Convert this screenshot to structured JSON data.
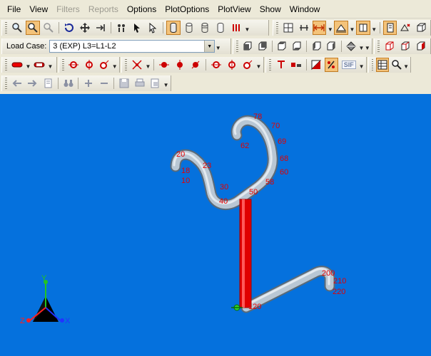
{
  "menu": {
    "items": [
      {
        "label": "File",
        "enabled": true
      },
      {
        "label": "View",
        "enabled": true
      },
      {
        "label": "Filters",
        "enabled": false
      },
      {
        "label": "Reports",
        "enabled": false
      },
      {
        "label": "Options",
        "enabled": true
      },
      {
        "label": "PlotOptions",
        "enabled": true
      },
      {
        "label": "PlotView",
        "enabled": true
      },
      {
        "label": "Show",
        "enabled": true
      },
      {
        "label": "Window",
        "enabled": true
      }
    ]
  },
  "load_case": {
    "label": "Load Case:",
    "value": "3 (EXP) L3=L1-L2"
  },
  "toolbar3": {
    "sif_label": "SIF"
  },
  "viewport": {
    "background": "#0571dd",
    "pipe_color": "#a9b9c8",
    "highlight_color": "#e00000",
    "node_labels": [
      "78",
      "70",
      "69",
      "68",
      "62",
      "20",
      "23",
      "18",
      "10",
      "30",
      "60",
      "58",
      "50",
      "40",
      "200",
      "210",
      "220",
      "120"
    ]
  },
  "axes": {
    "y": "Y",
    "x": "X",
    "z": "Z"
  },
  "colors": {
    "menubar_bg": "#ece9d8",
    "node_label": "#e40000",
    "pressed_button": "#f4c37a"
  }
}
